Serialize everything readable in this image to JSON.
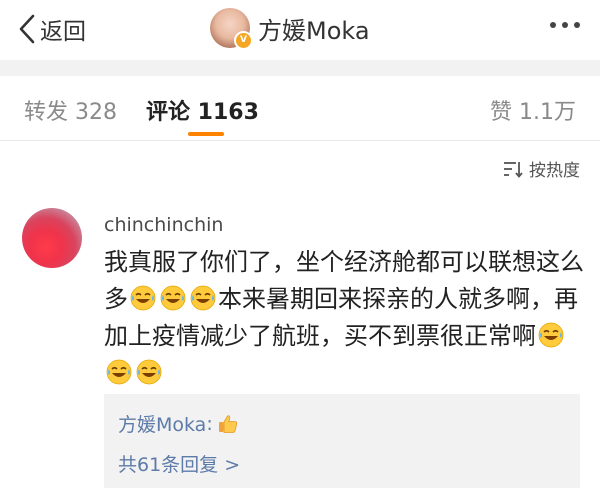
{
  "nav": {
    "back_label": "返回",
    "title": "方媛Moka",
    "icons": {
      "back": "chevron-left-icon",
      "more": "more-dots-icon",
      "verified": "verified-badge-icon"
    }
  },
  "tabs": [
    {
      "label": "转发 328",
      "active": false
    },
    {
      "label": "评论 1163",
      "active": true
    },
    {
      "label": "赞 1.1万",
      "active": false
    }
  ],
  "sort": {
    "label": "按热度",
    "icon": "sort-icon"
  },
  "comment": {
    "username": "chinchinchin",
    "text_part1": "我真服了你们了，坐个经济舱都可以联想这么多",
    "text_part2": "本来暑期回来探亲的人就多啊，再加上疫情减少了航班，买不到票很正常啊",
    "emoji": "laughing-with-tears-emoji",
    "reply": {
      "author": "方媛Moka",
      "colon": ":",
      "emoji": "thumbs-up-emoji",
      "more_label": "共61条回复 >"
    }
  },
  "colors": {
    "accent": "#ff8200",
    "link": "#5d7ba8",
    "verified": "#f5a623",
    "background_gray": "#f2f2f2"
  }
}
